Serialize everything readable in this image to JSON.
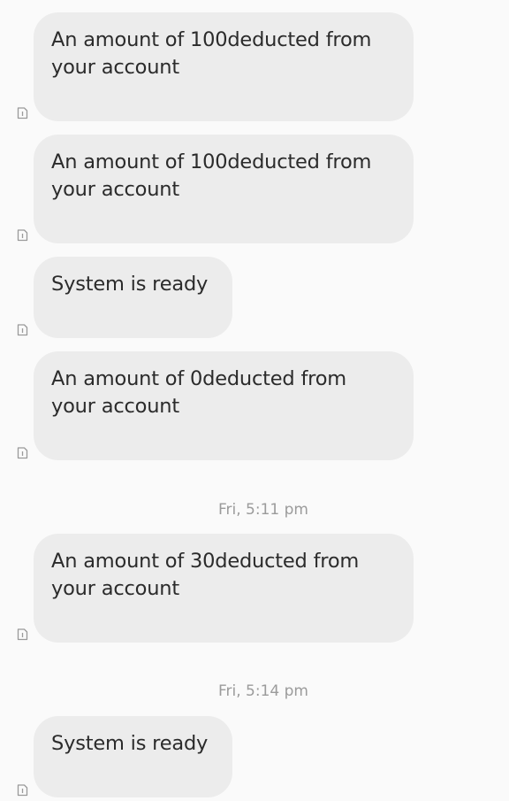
{
  "messages": [
    {
      "text": "An amount of 100deducted from\nyour account",
      "sim_icon": "sim-card-1-icon"
    },
    {
      "text": "An amount of 100deducted from\nyour account",
      "sim_icon": "sim-card-1-icon"
    },
    {
      "text": "System is ready",
      "sim_icon": "sim-card-1-icon"
    },
    {
      "text": "An amount of 0deducted from\nyour account",
      "sim_icon": "sim-card-1-icon"
    },
    {
      "text": "An amount of 30deducted from\nyour account",
      "sim_icon": "sim-card-1-icon"
    },
    {
      "text": "System is ready",
      "sim_icon": "sim-card-1-icon"
    }
  ],
  "timestamps": [
    "Fri, 5:11 pm",
    "Fri, 5:14 pm"
  ],
  "colors": {
    "background": "#fafafa",
    "bubble": "#ececec",
    "message_text": "#2b2b2b",
    "timestamp_text": "#9b9b9b",
    "sim_icon": "#9a9a9a"
  }
}
